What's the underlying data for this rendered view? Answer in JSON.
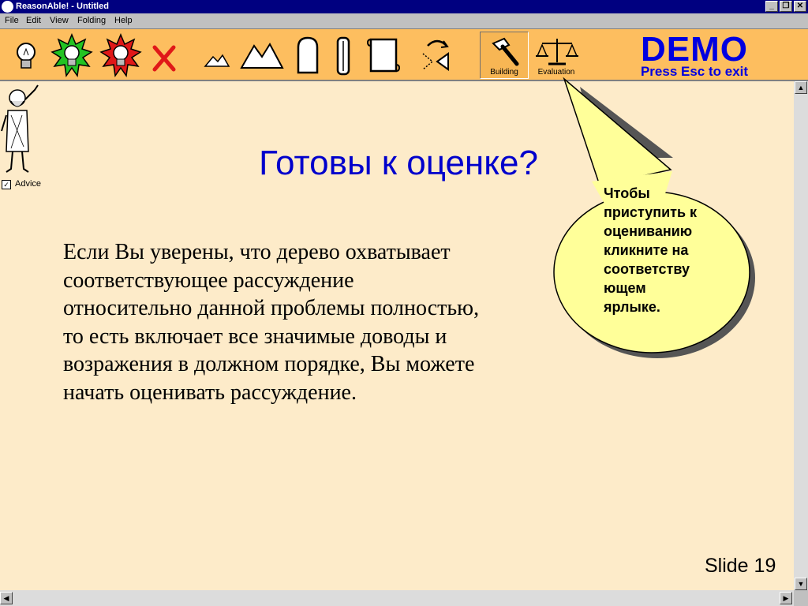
{
  "window": {
    "title": "ReasonAble! - Untitled",
    "minimize": "_",
    "restore": "❐",
    "close": "✕"
  },
  "menu": [
    "File",
    "Edit",
    "View",
    "Folding",
    "Help"
  ],
  "tabs": {
    "building": "Building",
    "evaluation": "Evaluation"
  },
  "demo": {
    "title": "DEMO",
    "subtitle": "Press Esc to exit"
  },
  "advice": {
    "checked": true,
    "label": "Advice"
  },
  "slide": {
    "heading": "Готовы к оценке?",
    "body": [
      "Если Вы уверены, что дерево охватывает",
      "соответствующее рассуждение",
      "относительно данной проблемы полностью,",
      "то есть включает все значимые доводы и",
      "возражения в должном порядке, Вы можете",
      "начать оценивать рассуждение."
    ],
    "number": "Slide 19"
  },
  "bubble": {
    "lines": [
      "Чтобы",
      "приступить к",
      "оцениванию",
      "кликните на",
      "соответству",
      "ющем",
      "ярлыке."
    ]
  },
  "colors": {
    "toolbar": "#fdbe5f",
    "background": "#fdebc9",
    "accent_blue": "#0000cc",
    "bubble": "#ffff99"
  },
  "icons": [
    "bulb-icon",
    "green-starburst-bulb-icon",
    "red-starburst-bulb-icon",
    "red-x-icon",
    "small-mountains-icon",
    "large-mountains-icon",
    "tombstone-icon",
    "pillar-icon",
    "scroll-icon",
    "rotate-arrow-icon",
    "hammer-icon",
    "scales-icon"
  ]
}
